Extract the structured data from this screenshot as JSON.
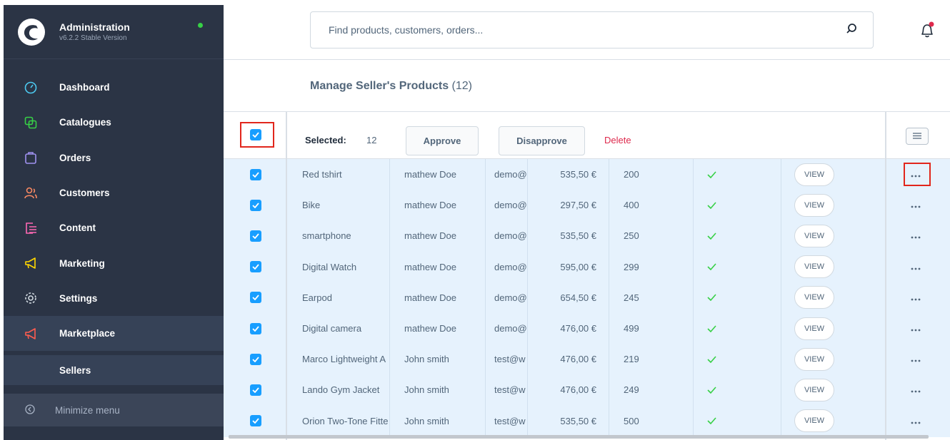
{
  "app": {
    "title": "Administration",
    "version": "v6.2.2 Stable Version"
  },
  "nav": [
    {
      "label": "Dashboard",
      "icon": "dashboard-gauge-icon",
      "color": "#4cc9f0"
    },
    {
      "label": "Catalogues",
      "icon": "catalogues-icon",
      "color": "#37d046"
    },
    {
      "label": "Orders",
      "icon": "orders-bag-icon",
      "color": "#a092f0"
    },
    {
      "label": "Customers",
      "icon": "customers-icon",
      "color": "#f88962"
    },
    {
      "label": "Content",
      "icon": "content-icon",
      "color": "#ff68b4"
    },
    {
      "label": "Marketing",
      "icon": "marketing-megaphone-icon",
      "color": "#ffd700"
    },
    {
      "label": "Settings",
      "icon": "settings-gear-icon",
      "color": "#d1d9e0"
    },
    {
      "label": "Marketplace",
      "icon": "marketplace-megaphone-icon",
      "color": "#ff5c4f"
    }
  ],
  "sub_nav": {
    "label": "Sellers"
  },
  "minimize": {
    "label": "Minimize menu"
  },
  "search": {
    "placeholder": "Find products, customers, orders..."
  },
  "page": {
    "title": "Manage Seller's Products",
    "count": "(12)"
  },
  "bulk": {
    "selected_label": "Selected:",
    "selected_count": "12",
    "approve": "Approve",
    "disapprove": "Disapprove",
    "delete": "Delete"
  },
  "rows": [
    {
      "name": "Red tshirt",
      "seller": "mathew Doe",
      "email": "demo@",
      "price": "535,50 €",
      "stock": "200",
      "view": "VIEW"
    },
    {
      "name": "Bike",
      "seller": "mathew Doe",
      "email": "demo@",
      "price": "297,50 €",
      "stock": "400",
      "view": "VIEW"
    },
    {
      "name": "smartphone",
      "seller": "mathew Doe",
      "email": "demo@",
      "price": "535,50 €",
      "stock": "250",
      "view": "VIEW"
    },
    {
      "name": "Digital Watch",
      "seller": "mathew Doe",
      "email": "demo@",
      "price": "595,00 €",
      "stock": "299",
      "view": "VIEW"
    },
    {
      "name": "Earpod",
      "seller": "mathew Doe",
      "email": "demo@",
      "price": "654,50 €",
      "stock": "245",
      "view": "VIEW"
    },
    {
      "name": "Digital camera",
      "seller": "mathew Doe",
      "email": "demo@",
      "price": "476,00 €",
      "stock": "499",
      "view": "VIEW"
    },
    {
      "name": "Marco Lightweight A",
      "seller": "John smith",
      "email": "test@w",
      "price": "476,00 €",
      "stock": "219",
      "view": "VIEW"
    },
    {
      "name": "Lando Gym Jacket",
      "seller": "John smith",
      "email": "test@w",
      "price": "476,00 €",
      "stock": "249",
      "view": "VIEW"
    },
    {
      "name": "Orion Two-Tone Fitte",
      "seller": "John smith",
      "email": "test@w",
      "price": "535,50 €",
      "stock": "500",
      "view": "VIEW"
    }
  ],
  "colors": {
    "sidebar": "#2b3445",
    "accent": "#189eff",
    "row_selected": "#e6f2fd",
    "delete": "#de294c",
    "check": "#37d046",
    "highlight": "#e1261c"
  }
}
